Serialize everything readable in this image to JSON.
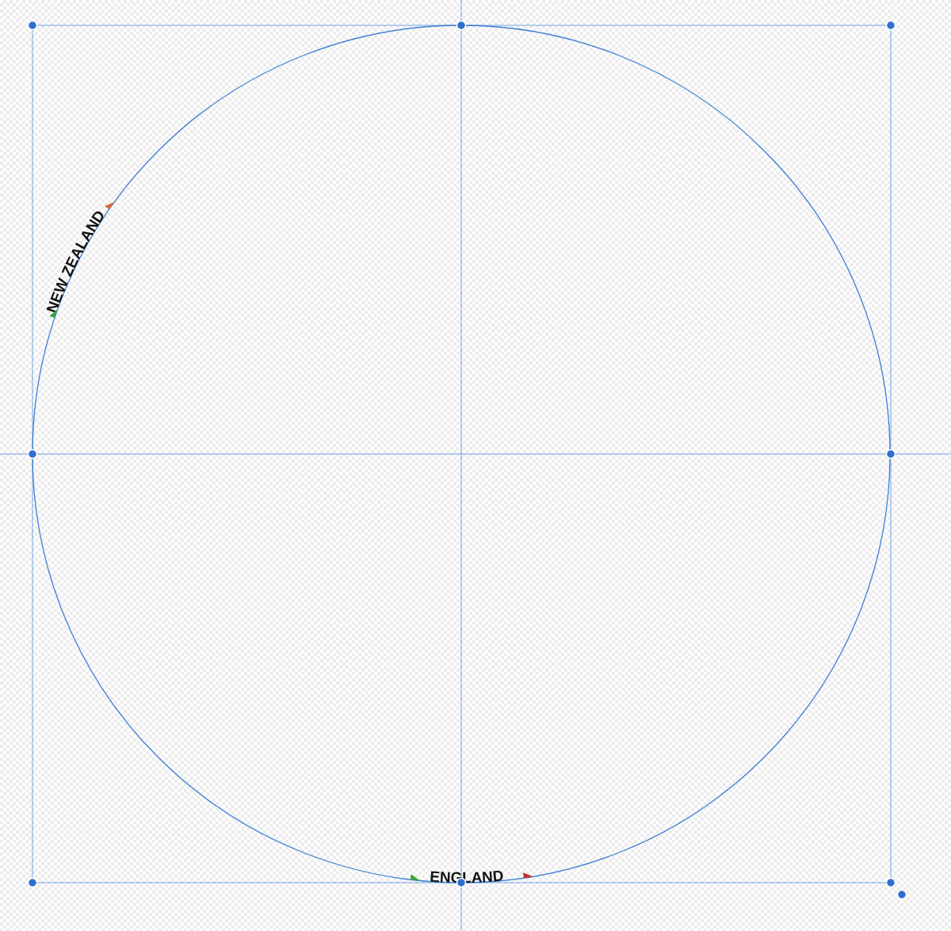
{
  "canvas": {
    "text_paths": [
      {
        "text": "NEW ZEALAND"
      },
      {
        "text": "ENGLAND"
      }
    ]
  }
}
